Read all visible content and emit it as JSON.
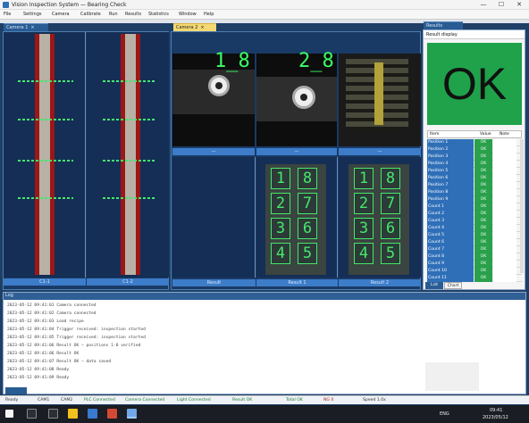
{
  "window": {
    "title": "Vision Inspection System — Bearing Check",
    "minimize": "—",
    "maximize": "☐",
    "close": "✕"
  },
  "menu": [
    "File",
    "Settings",
    "Camera",
    "Calibrate",
    "Run",
    "Results",
    "Statistics",
    "Window",
    "Help"
  ],
  "left_panel": {
    "tab_label": "Camera 1",
    "foot_labels": [
      "C1-1",
      "C1-2"
    ]
  },
  "middle_panel": {
    "tab_label": "Camera 2",
    "top_labels": [
      "1_8",
      "2_8"
    ],
    "top_foot_labels": [
      "—",
      "—",
      "—"
    ],
    "bottom_foot_labels": [
      "Result",
      "Result 1",
      "Result 2"
    ],
    "digit_grid_a": [
      [
        "1",
        "8"
      ],
      [
        "2",
        "7"
      ],
      [
        "3",
        "6"
      ],
      [
        "4",
        "5"
      ]
    ],
    "digit_grid_b": [
      [
        "1",
        "8"
      ],
      [
        "2",
        "7"
      ],
      [
        "3",
        "6"
      ],
      [
        "4",
        "5"
      ]
    ]
  },
  "right_panel": {
    "tab_label": "Results",
    "header_field": "Result display",
    "status": "OK",
    "status_color": "#1fa24a",
    "table_headers": [
      "Item",
      "Value",
      "Note"
    ],
    "rows": [
      {
        "name": "Position 1",
        "value": "OK"
      },
      {
        "name": "Position 2",
        "value": "OK"
      },
      {
        "name": "Position 3",
        "value": "OK"
      },
      {
        "name": "Position 4",
        "value": "OK"
      },
      {
        "name": "Position 5",
        "value": "OK"
      },
      {
        "name": "Position 6",
        "value": "OK"
      },
      {
        "name": "Position 7",
        "value": "OK"
      },
      {
        "name": "Position 8",
        "value": "OK"
      },
      {
        "name": "Position 9",
        "value": "OK"
      },
      {
        "name": "Count 1",
        "value": "OK"
      },
      {
        "name": "Count 2",
        "value": "OK"
      },
      {
        "name": "Count 3",
        "value": "OK"
      },
      {
        "name": "Count 4",
        "value": "OK"
      },
      {
        "name": "Count 5",
        "value": "OK"
      },
      {
        "name": "Count 6",
        "value": "OK"
      },
      {
        "name": "Count 7",
        "value": "OK"
      },
      {
        "name": "Count 8",
        "value": "OK"
      },
      {
        "name": "Count 9",
        "value": "OK"
      },
      {
        "name": "Count 10",
        "value": "OK"
      },
      {
        "name": "Count 11",
        "value": "OK"
      }
    ],
    "bottom_tabs": [
      "List",
      "Chart"
    ]
  },
  "log": {
    "title": "Log",
    "lines": [
      "2023-05-12 09:41:01  Camera connected",
      "2023-05-12 09:41:02  Camera connected",
      "2023-05-12 09:41:03  Load recipe",
      "2023-05-12 09:41:04  Trigger received: inspection started",
      "2023-05-12 09:41:05  Trigger received: inspection started",
      "2023-05-12 09:41:06  Result OK — positions 1-8 verified",
      "2023-05-12 09:41:06  Result OK",
      "2023-05-12 09:41:07  Result OK — data saved",
      "2023-05-12 09:41:08  Ready",
      "2023-05-12 09:41:09  Ready"
    ]
  },
  "status_bar": [
    "Ready",
    "CAM1",
    "CAM2",
    "PLC Connected",
    "Camera Connected",
    "Light Connected",
    "Result OK",
    "Total OK",
    "NG 0",
    "Speed 1.0x"
  ],
  "taskbar": {
    "time": "09:41",
    "date": "2023/05/12",
    "lang": "ENG"
  }
}
